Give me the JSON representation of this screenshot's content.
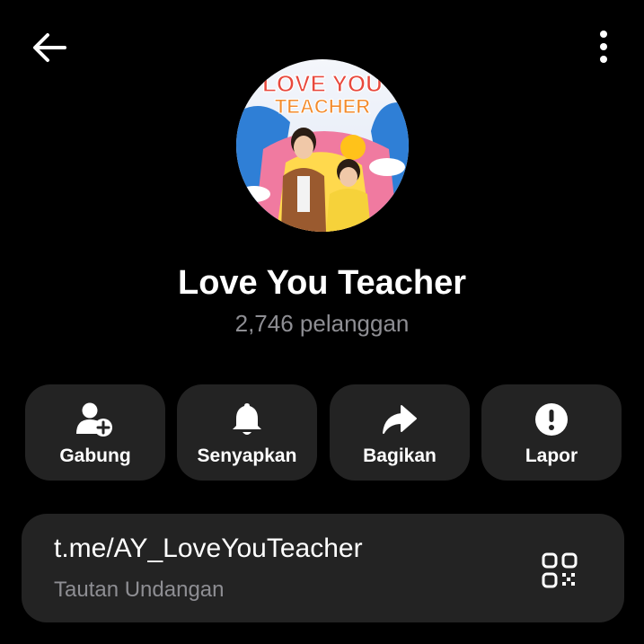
{
  "header": {
    "back_icon": "arrow-left-icon",
    "menu_icon": "more-vertical-icon"
  },
  "channel": {
    "avatar_text_line1": "LOVE YOU",
    "avatar_text_line2": "TEACHER",
    "name": "Love You Teacher",
    "subscribers": "2,746 pelanggan"
  },
  "actions": [
    {
      "label": "Gabung",
      "icon": "add-user-icon"
    },
    {
      "label": "Senyapkan",
      "icon": "bell-icon"
    },
    {
      "label": "Bagikan",
      "icon": "share-arrow-icon"
    },
    {
      "label": "Lapor",
      "icon": "exclamation-circle-icon"
    }
  ],
  "link": {
    "url": "t.me/AY_LoveYouTeacher",
    "caption": "Tautan Undangan",
    "qr_icon": "qr-code-icon"
  },
  "colors": {
    "background": "#000000",
    "card": "#232323",
    "text": "#ffffff",
    "muted": "#8e8e93"
  }
}
